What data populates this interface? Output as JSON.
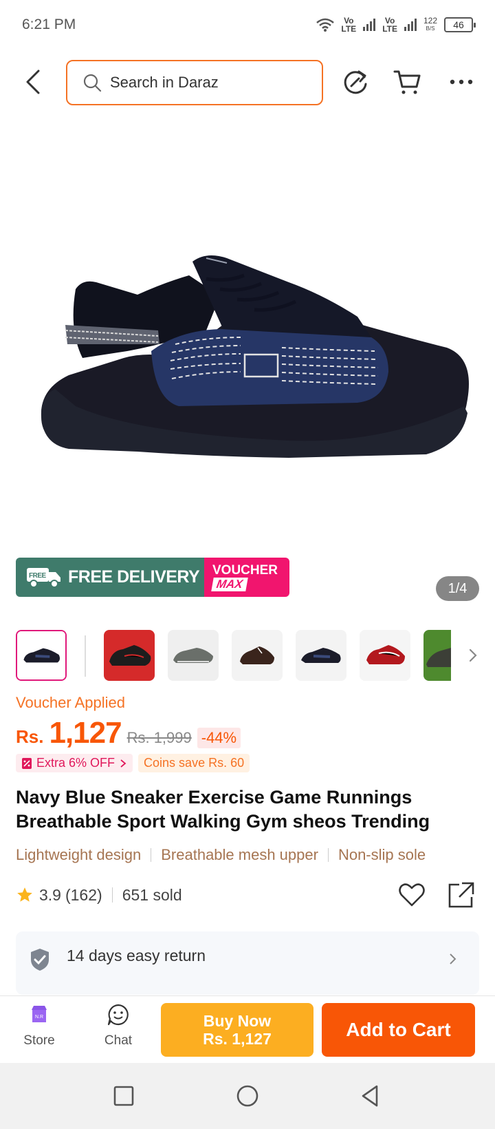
{
  "status_bar": {
    "time": "6:21 PM",
    "lte1": "Vo",
    "lte1b": "LTE",
    "lte2": "Vo",
    "lte2b": "LTE",
    "speed": "122",
    "speed_unit": "B/S",
    "battery": "46"
  },
  "header": {
    "search_placeholder": "Search in Daraz"
  },
  "gallery": {
    "counter": "1/4",
    "banner_free": "FREE DELIVERY",
    "banner_free_tag": "FREE",
    "banner_voucher": "VOUCHER",
    "banner_max": "MAX"
  },
  "price": {
    "voucher_applied": "Voucher Applied",
    "currency": "Rs.",
    "current": "1,127",
    "original": "Rs. 1,999",
    "discount": "-44%",
    "promo_extra": "Extra 6% OFF",
    "promo_coins": "Coins save Rs. 60"
  },
  "product": {
    "title": "Navy Blue Sneaker Exercise Game Runnings Breathable Sport Walking Gym sheos Trending",
    "features": [
      "Lightweight design",
      "Breathable mesh upper",
      "Non-slip sole"
    ],
    "rating": "3.9",
    "reviews": "(162)",
    "sold": "651 sold"
  },
  "service": {
    "return": "14 days easy return"
  },
  "bottom_bar": {
    "store_label": "Store",
    "store_badge": "N.R",
    "chat_label": "Chat",
    "buy_now_line1": "Buy Now",
    "buy_now_line2": "Rs. 1,127",
    "add_to_cart": "Add to Cart"
  },
  "colors": {
    "accent": "#f85606",
    "buy_now": "#fcae21",
    "search_border": "#f57224",
    "free_delivery": "#3f7b6b",
    "voucher_max": "#f1156e"
  }
}
